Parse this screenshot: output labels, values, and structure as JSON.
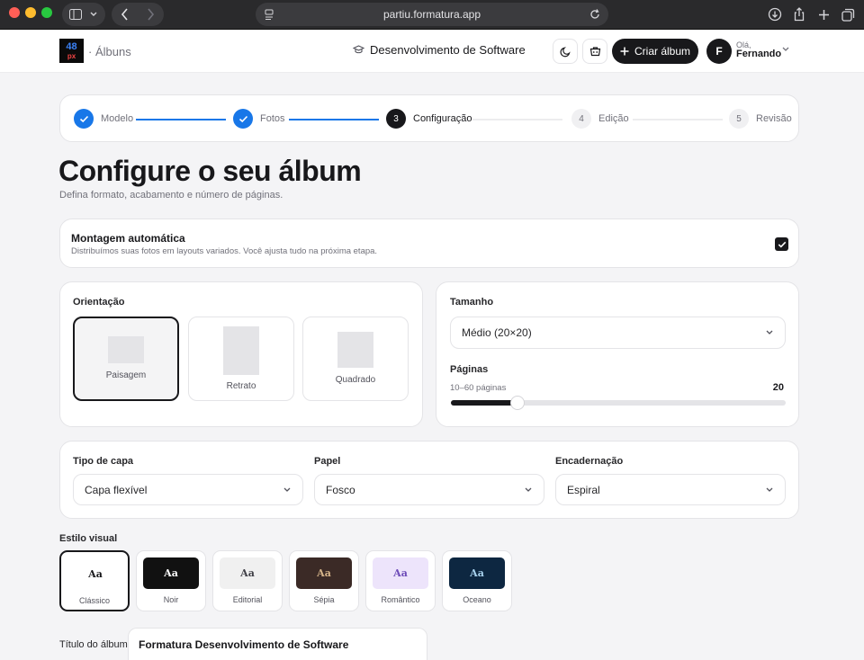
{
  "browser": {
    "url": "partiu.formatura.app"
  },
  "header": {
    "logo_top": "48",
    "logo_bottom": "px",
    "breadcrumb": "· Álbuns",
    "course": "Desenvolvimento de Software",
    "create_label": "Criar álbum",
    "avatar_initial": "F",
    "greeting": "Olá,",
    "user_name": "Fernando"
  },
  "stepper": {
    "steps": [
      {
        "number": "1",
        "label": "Modelo",
        "state": "done"
      },
      {
        "number": "2",
        "label": "Fotos",
        "state": "done"
      },
      {
        "number": "3",
        "label": "Configuração",
        "state": "active"
      },
      {
        "number": "4",
        "label": "Edição",
        "state": "todo"
      },
      {
        "number": "5",
        "label": "Revisão",
        "state": "todo"
      }
    ]
  },
  "page": {
    "title": "Configure o seu álbum",
    "subtitle": "Defina formato, acabamento e número de páginas."
  },
  "auto_layout": {
    "title": "Montagem automática",
    "description": "Distribuímos suas fotos em layouts variados. Você ajusta tudo na próxima etapa.",
    "checked": true
  },
  "orientation": {
    "label": "Orientação",
    "options": [
      "Paisagem",
      "Retrato",
      "Quadrado"
    ],
    "selected": "Paisagem"
  },
  "size": {
    "label": "Tamanho",
    "value": "Médio (20×20)"
  },
  "pages": {
    "label": "Páginas",
    "hint": "10–60 páginas",
    "value": "20",
    "min": 10,
    "max": 60
  },
  "finish": {
    "cover": {
      "label": "Tipo de capa",
      "value": "Capa flexível"
    },
    "paper": {
      "label": "Papel",
      "value": "Fosco"
    },
    "binding": {
      "label": "Encadernação",
      "value": "Espiral"
    }
  },
  "visual_style": {
    "label": "Estilo visual",
    "sample": "Aa",
    "selected": "Clássico",
    "options": [
      {
        "name": "Clássico",
        "bg": "#ffffff",
        "fg": "#18181b"
      },
      {
        "name": "Noir",
        "bg": "#111111",
        "fg": "#ffffff"
      },
      {
        "name": "Editorial",
        "bg": "#f0f0f0",
        "fg": "#3f3f46"
      },
      {
        "name": "Sépia",
        "bg": "#3b2a26",
        "fg": "#d6b58a"
      },
      {
        "name": "Romântico",
        "bg": "#ede4fb",
        "fg": "#6d4bb8"
      },
      {
        "name": "Oceano",
        "bg": "#0d2741",
        "fg": "#a9d3ef"
      }
    ]
  },
  "album_title": {
    "label": "Título do álbum",
    "value": "Formatura Desenvolvimento de Software"
  },
  "colors": {
    "accent": "#1877e8",
    "dark": "#18181b"
  }
}
